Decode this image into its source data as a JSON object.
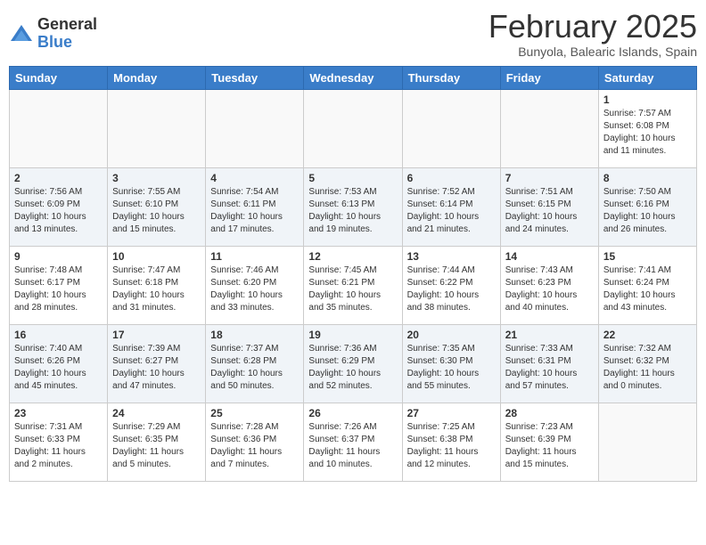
{
  "logo": {
    "general": "General",
    "blue": "Blue"
  },
  "title": {
    "month_year": "February 2025",
    "location": "Bunyola, Balearic Islands, Spain"
  },
  "days_of_week": [
    "Sunday",
    "Monday",
    "Tuesday",
    "Wednesday",
    "Thursday",
    "Friday",
    "Saturday"
  ],
  "weeks": [
    {
      "shaded": false,
      "days": [
        {
          "num": "",
          "info": ""
        },
        {
          "num": "",
          "info": ""
        },
        {
          "num": "",
          "info": ""
        },
        {
          "num": "",
          "info": ""
        },
        {
          "num": "",
          "info": ""
        },
        {
          "num": "",
          "info": ""
        },
        {
          "num": "1",
          "info": "Sunrise: 7:57 AM\nSunset: 6:08 PM\nDaylight: 10 hours\nand 11 minutes."
        }
      ]
    },
    {
      "shaded": true,
      "days": [
        {
          "num": "2",
          "info": "Sunrise: 7:56 AM\nSunset: 6:09 PM\nDaylight: 10 hours\nand 13 minutes."
        },
        {
          "num": "3",
          "info": "Sunrise: 7:55 AM\nSunset: 6:10 PM\nDaylight: 10 hours\nand 15 minutes."
        },
        {
          "num": "4",
          "info": "Sunrise: 7:54 AM\nSunset: 6:11 PM\nDaylight: 10 hours\nand 17 minutes."
        },
        {
          "num": "5",
          "info": "Sunrise: 7:53 AM\nSunset: 6:13 PM\nDaylight: 10 hours\nand 19 minutes."
        },
        {
          "num": "6",
          "info": "Sunrise: 7:52 AM\nSunset: 6:14 PM\nDaylight: 10 hours\nand 21 minutes."
        },
        {
          "num": "7",
          "info": "Sunrise: 7:51 AM\nSunset: 6:15 PM\nDaylight: 10 hours\nand 24 minutes."
        },
        {
          "num": "8",
          "info": "Sunrise: 7:50 AM\nSunset: 6:16 PM\nDaylight: 10 hours\nand 26 minutes."
        }
      ]
    },
    {
      "shaded": false,
      "days": [
        {
          "num": "9",
          "info": "Sunrise: 7:48 AM\nSunset: 6:17 PM\nDaylight: 10 hours\nand 28 minutes."
        },
        {
          "num": "10",
          "info": "Sunrise: 7:47 AM\nSunset: 6:18 PM\nDaylight: 10 hours\nand 31 minutes."
        },
        {
          "num": "11",
          "info": "Sunrise: 7:46 AM\nSunset: 6:20 PM\nDaylight: 10 hours\nand 33 minutes."
        },
        {
          "num": "12",
          "info": "Sunrise: 7:45 AM\nSunset: 6:21 PM\nDaylight: 10 hours\nand 35 minutes."
        },
        {
          "num": "13",
          "info": "Sunrise: 7:44 AM\nSunset: 6:22 PM\nDaylight: 10 hours\nand 38 minutes."
        },
        {
          "num": "14",
          "info": "Sunrise: 7:43 AM\nSunset: 6:23 PM\nDaylight: 10 hours\nand 40 minutes."
        },
        {
          "num": "15",
          "info": "Sunrise: 7:41 AM\nSunset: 6:24 PM\nDaylight: 10 hours\nand 43 minutes."
        }
      ]
    },
    {
      "shaded": true,
      "days": [
        {
          "num": "16",
          "info": "Sunrise: 7:40 AM\nSunset: 6:26 PM\nDaylight: 10 hours\nand 45 minutes."
        },
        {
          "num": "17",
          "info": "Sunrise: 7:39 AM\nSunset: 6:27 PM\nDaylight: 10 hours\nand 47 minutes."
        },
        {
          "num": "18",
          "info": "Sunrise: 7:37 AM\nSunset: 6:28 PM\nDaylight: 10 hours\nand 50 minutes."
        },
        {
          "num": "19",
          "info": "Sunrise: 7:36 AM\nSunset: 6:29 PM\nDaylight: 10 hours\nand 52 minutes."
        },
        {
          "num": "20",
          "info": "Sunrise: 7:35 AM\nSunset: 6:30 PM\nDaylight: 10 hours\nand 55 minutes."
        },
        {
          "num": "21",
          "info": "Sunrise: 7:33 AM\nSunset: 6:31 PM\nDaylight: 10 hours\nand 57 minutes."
        },
        {
          "num": "22",
          "info": "Sunrise: 7:32 AM\nSunset: 6:32 PM\nDaylight: 11 hours\nand 0 minutes."
        }
      ]
    },
    {
      "shaded": false,
      "days": [
        {
          "num": "23",
          "info": "Sunrise: 7:31 AM\nSunset: 6:33 PM\nDaylight: 11 hours\nand 2 minutes."
        },
        {
          "num": "24",
          "info": "Sunrise: 7:29 AM\nSunset: 6:35 PM\nDaylight: 11 hours\nand 5 minutes."
        },
        {
          "num": "25",
          "info": "Sunrise: 7:28 AM\nSunset: 6:36 PM\nDaylight: 11 hours\nand 7 minutes."
        },
        {
          "num": "26",
          "info": "Sunrise: 7:26 AM\nSunset: 6:37 PM\nDaylight: 11 hours\nand 10 minutes."
        },
        {
          "num": "27",
          "info": "Sunrise: 7:25 AM\nSunset: 6:38 PM\nDaylight: 11 hours\nand 12 minutes."
        },
        {
          "num": "28",
          "info": "Sunrise: 7:23 AM\nSunset: 6:39 PM\nDaylight: 11 hours\nand 15 minutes."
        },
        {
          "num": "",
          "info": ""
        }
      ]
    }
  ]
}
